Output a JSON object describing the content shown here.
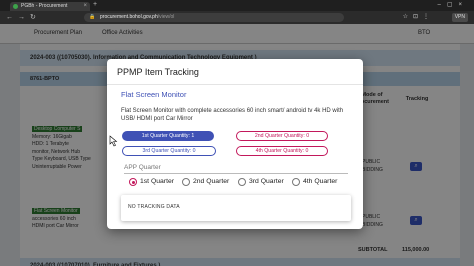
{
  "browser": {
    "tab_title": "PGBh - Procurement",
    "url_host": "procurement.bohol.gov.ph",
    "url_path": "/view/ol",
    "vpn_label": "VPN"
  },
  "page": {
    "nav": [
      "Procurement Plan",
      "Office Activities",
      "BTO"
    ],
    "section_1": "2024-003 ((10705030). Information and Communication Technology Equipment )",
    "code_row": "8761-BPTO",
    "column_mode": "Mode of Procurement",
    "column_tracking": "Tracking",
    "row1_title": "Desktop Computer S",
    "row1_lines": [
      "Memory: 16Gigab",
      "HDD: 1 Terabyte",
      "monitor, Network Hub",
      "Type Keyboard, USB Type",
      "Uninterruptable Power"
    ],
    "row2_title": "Flat Screen Monitor",
    "row2_lines": [
      "accessories 60 inch",
      "HDMI port Car Mirror"
    ],
    "mode_1": [
      "PUBLIC",
      "BIDDING"
    ],
    "mode_2": [
      "PUBLIC",
      "BIDDING"
    ],
    "subtotal_label": "SUBTOTAL",
    "subtotal_value": "115,000.00",
    "section_2": "2024-003 ((10707010). Furniture and Fixtures )"
  },
  "modal": {
    "title": "PPMP Item Tracking",
    "item_name": "Flat Screen Monitor",
    "item_description": "Flat Screen Monitor with complete accessories 60 inch smart/ android tv 4k HD with USB/ HDMI port Car Mirror",
    "quarters": [
      {
        "label": "1st Quarter Quantity: 1",
        "active": true,
        "color": "#3f51b5"
      },
      {
        "label": "2nd Quarter Quantity: 0",
        "active": false,
        "color": "#c2185b"
      },
      {
        "label": "3rd Quarter Quantity: 0",
        "active": false,
        "color": "#3f51b5"
      },
      {
        "label": "4th Quarter Quantity: 0",
        "active": false,
        "color": "#c2185b"
      }
    ],
    "app_label": "APP Quarter",
    "radio_options": [
      "1st Quarter",
      "2nd Quarter",
      "3rd Quarter",
      "4th Quarter"
    ],
    "radio_selected": "1st Quarter",
    "tracking_empty": "NO TRACKING DATA"
  }
}
